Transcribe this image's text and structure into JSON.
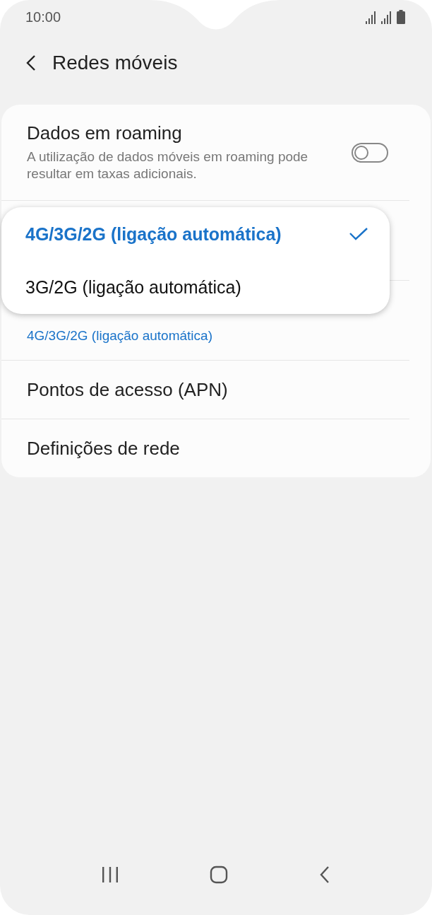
{
  "status_bar": {
    "time": "10:00"
  },
  "header": {
    "title": "Redes móveis"
  },
  "rows": [
    {
      "kind": "toggle",
      "title": "Dados em roaming",
      "subtitle": "A utilização de dados móveis em roaming pode resultar em taxas adicionais.",
      "on": false
    },
    {
      "kind": "value",
      "value": "4G/3G/2G (ligação automática)"
    },
    {
      "kind": "plain",
      "title": "Pontos de acesso (APN)"
    },
    {
      "kind": "plain",
      "title": "Definições de rede"
    }
  ],
  "popup": {
    "options": [
      {
        "label": "4G/3G/2G (ligação automática)",
        "selected": true
      },
      {
        "label": "3G/2G (ligação automática)",
        "selected": false
      }
    ]
  }
}
